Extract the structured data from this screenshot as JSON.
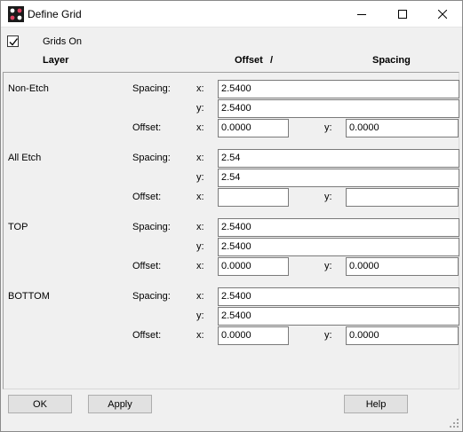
{
  "window": {
    "title": "Define Grid"
  },
  "titlebar_buttons": {
    "minimize_icon": "minimize-icon",
    "maximize_icon": "maximize-icon",
    "close_icon": "close-icon"
  },
  "grids_on": {
    "label": "Grids On",
    "checked": true
  },
  "headers": {
    "layer": "Layer",
    "offset": "Offset",
    "slash": "/",
    "spacing": "Spacing"
  },
  "labels": {
    "spacing": "Spacing:",
    "offset": "Offset:",
    "x": "x:",
    "y": "y:"
  },
  "layers": [
    {
      "name": "Non-Etch",
      "spacing_x": "2.5400",
      "spacing_y": "2.5400",
      "offset_x": "0.0000",
      "offset_y": "0.0000"
    },
    {
      "name": "All Etch",
      "spacing_x": "2.54",
      "spacing_y": "2.54",
      "offset_x": "",
      "offset_y": ""
    },
    {
      "name": "TOP",
      "spacing_x": "2.5400",
      "spacing_y": "2.5400",
      "offset_x": "0.0000",
      "offset_y": "0.0000"
    },
    {
      "name": "BOTTOM",
      "spacing_x": "2.5400",
      "spacing_y": "2.5400",
      "offset_x": "0.0000",
      "offset_y": "0.0000"
    }
  ],
  "buttons": {
    "ok": "OK",
    "apply": "Apply",
    "help": "Help"
  }
}
